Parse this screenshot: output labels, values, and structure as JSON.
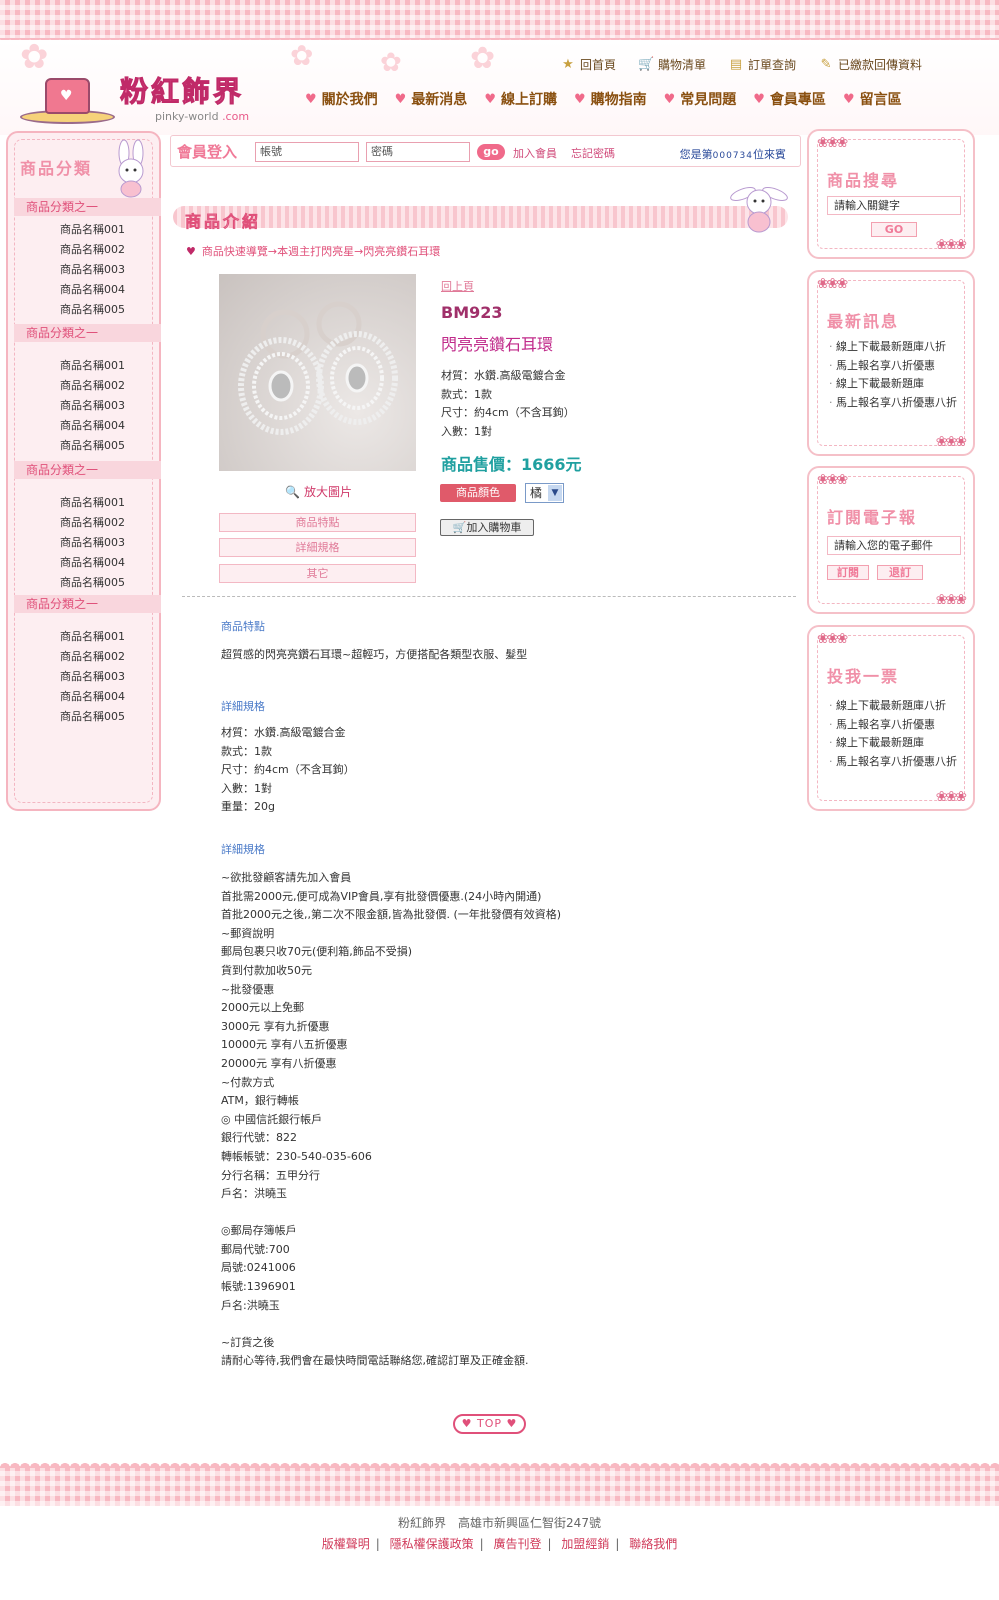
{
  "header": {
    "logo_text": "粉紅飾界",
    "logo_sub_main": "pinky-world",
    "logo_sub_tld": ".com",
    "top_links": [
      "回首頁",
      "購物清單",
      "訂單查詢",
      "已繳款回傳資料"
    ],
    "nav": [
      "關於我們",
      "最新消息",
      "線上訂購",
      "購物指南",
      "常見問題",
      "會員專區",
      "留言區"
    ]
  },
  "sidebar": {
    "title": "商品分類",
    "groups": [
      {
        "head": "商品分類之一",
        "items": [
          "商品名稱001",
          "商品名稱002",
          "商品名稱003",
          "商品名稱004",
          "商品名稱005"
        ]
      },
      {
        "head": "商品分類之一",
        "items": [
          "商品名稱001",
          "商品名稱002",
          "商品名稱003",
          "商品名稱004",
          "商品名稱005"
        ]
      },
      {
        "head": "商品分類之一",
        "items": [
          "商品名稱001",
          "商品名稱002",
          "商品名稱003",
          "商品名稱004",
          "商品名稱005"
        ]
      },
      {
        "head": "商品分類之一",
        "items": [
          "商品名稱001",
          "商品名稱002",
          "商品名稱003",
          "商品名稱004",
          "商品名稱005"
        ]
      }
    ]
  },
  "login": {
    "label": "會員登入",
    "account_placeholder": "帳號",
    "password_placeholder": "密碼",
    "go": "go",
    "join": "加入會員",
    "forgot": "忘記密碼",
    "visitor_prefix": "您是第",
    "visitor_count": "000734",
    "visitor_suffix": "位來賓"
  },
  "section_title": "商品介紹",
  "breadcrumb": "商品快速導覽→本週主打閃亮星→閃亮亮鑽石耳環",
  "product": {
    "back": "回上頁",
    "code": "BM923",
    "name": "閃亮亮鑽石耳環",
    "specs": [
      "材質：水鑽.高級電鍍合金",
      "款式：1款",
      "尺寸：約4cm（不含耳鉤）",
      "入數：1對"
    ],
    "price": "商品售價：1666元",
    "color_label": "商品顏色",
    "color_value": "橘",
    "cart": "加入購物車",
    "zoom": "放大圖片",
    "tabs": [
      "商品特點",
      "詳細規格",
      "其它"
    ]
  },
  "details": {
    "h1": "商品特點",
    "feature": "超質感的閃亮亮鑽石耳環~超輕巧，方便搭配各類型衣服、髮型",
    "h2": "詳細規格",
    "spec_lines": [
      "材質：水鑽.高級電鍍合金",
      "款式：1款",
      "尺寸：約4cm（不含耳鉤）",
      "入數：1對",
      "重量：20g"
    ],
    "h3": "詳細規格",
    "info_lines": [
      "~欲批發顧客請先加入會員",
      "首批需2000元,便可成為VIP會員,享有批發價優惠.(24小時內開通)",
      "首批2000元之後,,第二次不限金額,皆為批發價. (一年批發價有效資格)",
      "~郵資說明",
      "郵局包裹只收70元(便利箱,飾品不受損)",
      "貨到付款加收50元",
      "~批發優惠",
      "2000元以上免郵",
      "3000元 享有九折優惠",
      "10000元 享有八五折優惠",
      "20000元 享有八折優惠",
      "~付款方式",
      "ATM，銀行轉帳",
      "◎ 中國信託銀行帳戶",
      "銀行代號：822",
      "轉帳帳號：230-540-035-606",
      "分行名稱：五甲分行",
      "戶名：洪曉玉",
      "",
      "◎郵局存簿帳戶",
      "郵局代號:700",
      "局號:0241006",
      "帳號:1396901",
      "戶名:洪曉玉",
      "",
      "~訂貨之後",
      "請耐心等待,我們會在最快時間電話聯絡您,確認訂單及正確金額."
    ],
    "top": "TOP"
  },
  "right": {
    "search": {
      "title": "商品搜尋",
      "placeholder": "請輸入關鍵字",
      "go": "GO"
    },
    "news": {
      "title": "最新訊息",
      "items": [
        "線上下載最新題庫八折",
        "馬上報名享八折優惠",
        "線上下載最新題庫",
        "馬上報名享八折優惠八折"
      ]
    },
    "epaper": {
      "title": "訂閱電子報",
      "placeholder": "請輸入您的電子郵件",
      "subscribe": "訂閱",
      "unsubscribe": "退訂"
    },
    "vote": {
      "title": "投我一票",
      "items": [
        "線上下載最新題庫八折",
        "馬上報名享八折優惠",
        "線上下載最新題庫",
        "馬上報名享八折優惠八折"
      ]
    }
  },
  "footer": {
    "name": "粉紅飾界",
    "address": "高雄市新興區仁智街247號",
    "links": [
      "版權聲明",
      "隱私權保護政策",
      "廣告刊登",
      "加盟經銷",
      "聯絡我們"
    ]
  },
  "colors": {
    "pink": "#f8b9c2",
    "accent": "#e0507a",
    "price": "#20a0a0",
    "link_blue": "#4a7ac8"
  }
}
